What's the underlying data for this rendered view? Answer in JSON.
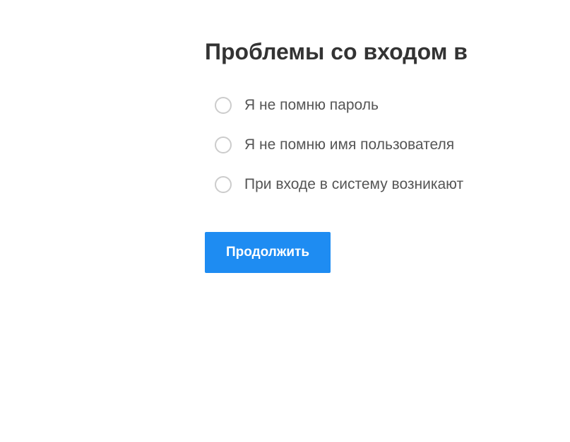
{
  "heading": "Проблемы со входом в",
  "options": [
    {
      "label": "Я не помню пароль"
    },
    {
      "label": "Я не помню имя пользователя"
    },
    {
      "label": "При входе в систему возникают"
    }
  ],
  "continue_label": "Продолжить"
}
